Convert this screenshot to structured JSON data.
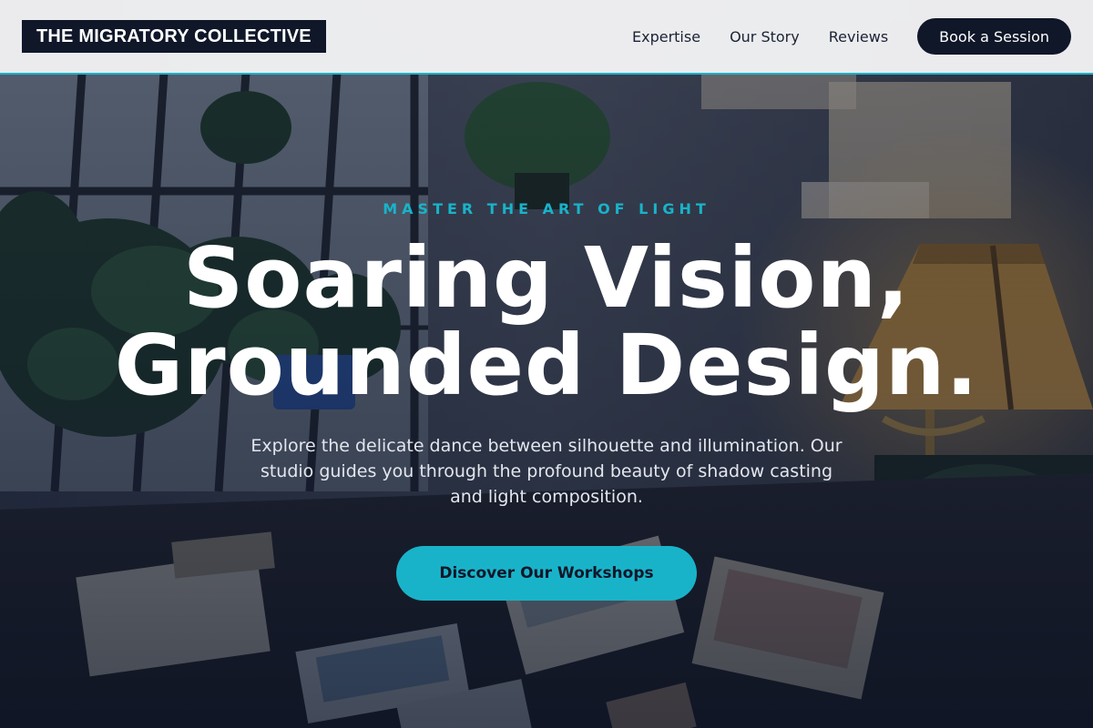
{
  "header": {
    "logo_text": "THE MIGRATORY COLLECTIVE",
    "nav": [
      "Expertise",
      "Our Story",
      "Reviews"
    ],
    "cta_label": "Book a Session"
  },
  "hero": {
    "eyebrow": "MASTER THE ART OF LIGHT",
    "headline_line1": "Soaring Vision,",
    "headline_line2": "Grounded Design.",
    "subcopy": "Explore the delicate dance between silhouette and illumination. Our studio guides you through the profound beauty of shadow casting and light composition.",
    "cta_label": "Discover Our Workshops"
  },
  "colors": {
    "accent": "#19b3c9",
    "navy": "#0f1729",
    "header_bg": "#f5f5f7",
    "text_light": "#e3e6ee"
  }
}
